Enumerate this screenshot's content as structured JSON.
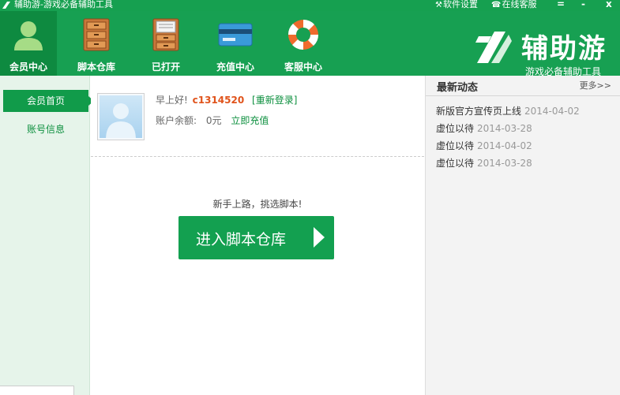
{
  "titlebar": {
    "title": "辅助游-游戏必备辅助工具",
    "settings_label": "软件设置",
    "service_label": "在线客服",
    "minimize": "=",
    "maximize": "-",
    "close": "x"
  },
  "toolbar": {
    "items": [
      {
        "label": "会员中心",
        "icon": "member-icon"
      },
      {
        "label": "脚本仓库",
        "icon": "cabinet-icon"
      },
      {
        "label": "已打开",
        "icon": "open-cabinet-icon"
      },
      {
        "label": "充值中心",
        "icon": "card-icon"
      },
      {
        "label": "客服中心",
        "icon": "lifebuoy-icon"
      }
    ]
  },
  "brand": {
    "name": "辅助游",
    "slogan": "游戏必备辅助工具"
  },
  "sidebar": {
    "items": [
      {
        "label": "会员首页"
      },
      {
        "label": "账号信息"
      }
    ]
  },
  "main": {
    "greeting": "早上好!",
    "username": "c1314520",
    "relogin": "[重新登录]",
    "balance_label": "账户余额:",
    "balance_value": "0元",
    "recharge": "立即充值",
    "hint": "新手上路，挑选脚本!",
    "enter_button": "进入脚本仓库"
  },
  "news": {
    "title": "最新动态",
    "more": "更多>>",
    "items": [
      {
        "text": "新版官方宣传页上线",
        "date": "2014-04-02"
      },
      {
        "text": "虚位以待",
        "date": "2014-03-28"
      },
      {
        "text": "虚位以待",
        "date": "2014-04-02"
      },
      {
        "text": "虚位以待",
        "date": "2014-03-28"
      }
    ]
  },
  "colors": {
    "primary_green": "#17a052",
    "username_orange": "#e0531b",
    "link_green": "#0c8f3e"
  }
}
